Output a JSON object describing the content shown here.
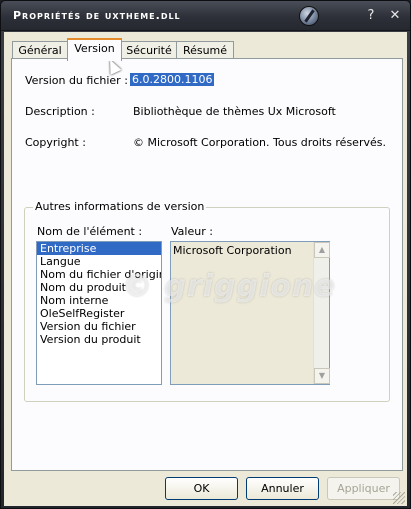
{
  "window": {
    "title": "Propriétés de uxtheme.dll",
    "buttons": {
      "help": "?",
      "close": "✕"
    }
  },
  "tabs": [
    {
      "label": "Général"
    },
    {
      "label": "Version",
      "active": true
    },
    {
      "label": "Sécurité"
    },
    {
      "label": "Résumé"
    }
  ],
  "version_tab": {
    "file_version_label": "Version du fichier :",
    "file_version_value": "6.0.2800.1106",
    "description_label": "Description :",
    "description_value": "Bibliothèque de thèmes Ux Microsoft",
    "copyright_label": "Copyright :",
    "copyright_value": "© Microsoft Corporation. Tous droits réservés.",
    "group_title": "Autres informations de version",
    "item_name_header": "Nom de l'élément :",
    "value_header": "Valeur :",
    "items": [
      "Entreprise",
      "Langue",
      "Nom du fichier d'origine",
      "Nom du produit",
      "Nom interne",
      "OleSelfRegister",
      "Version du fichier",
      "Version du produit"
    ],
    "selected_item_index": 0,
    "value_text": "Microsoft Corporation"
  },
  "footer": {
    "ok": "OK",
    "cancel": "Annuler",
    "apply": "Appliquer"
  },
  "watermark": "© griggione"
}
